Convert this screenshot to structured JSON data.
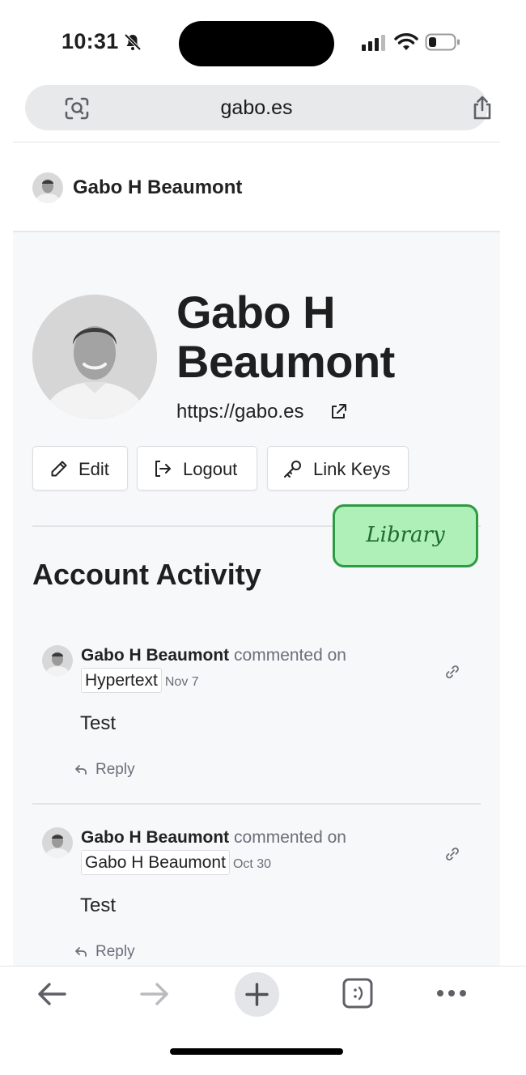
{
  "status_bar": {
    "time": "10:31"
  },
  "browser": {
    "url": "gabo.es"
  },
  "site_header": {
    "name": "Gabo H Beaumont"
  },
  "profile": {
    "name": "Gabo H Beaumont",
    "url": "https://gabo.es",
    "actions": {
      "edit": "Edit",
      "logout": "Logout",
      "link_keys": "Link Keys"
    }
  },
  "badge": {
    "label": "Library",
    "fill": "#aef0b8",
    "border": "#2e9a43"
  },
  "activity": {
    "title": "Account Activity",
    "items": [
      {
        "author": "Gabo H Beaumont",
        "verb": "commented on",
        "target": "Hypertext",
        "date": "Nov 7",
        "body": "Test",
        "reply": "Reply"
      },
      {
        "author": "Gabo H Beaumont",
        "verb": "commented on",
        "target": "Gabo H Beaumont",
        "date": "Oct 30",
        "body": "Test",
        "reply": "Reply"
      }
    ]
  },
  "toolbar": {
    "icons": [
      "back-arrow-icon",
      "forward-arrow-icon",
      "plus-icon",
      "tabs-icon",
      "more-icon"
    ]
  }
}
